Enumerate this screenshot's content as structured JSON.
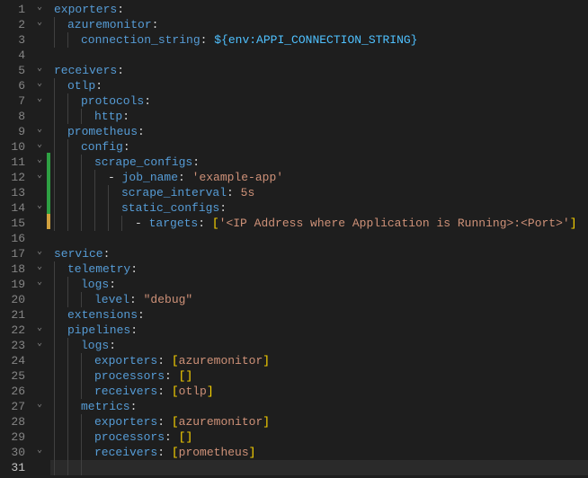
{
  "line_numbers": [
    "1",
    "2",
    "3",
    "4",
    "5",
    "6",
    "7",
    "8",
    "9",
    "10",
    "11",
    "12",
    "13",
    "14",
    "15",
    "16",
    "17",
    "18",
    "19",
    "20",
    "21",
    "22",
    "23",
    "24",
    "25",
    "26",
    "27",
    "28",
    "29",
    "30",
    "31"
  ],
  "fold_markers": {
    "1": "v",
    "2": "v",
    "3": "",
    "4": "",
    "5": "v",
    "6": "v",
    "7": "v",
    "8": "",
    "9": "v",
    "10": "v",
    "11": "v",
    "12": "v",
    "13": "",
    "14": "v",
    "15": "",
    "16": "",
    "17": "v",
    "18": "v",
    "19": "v",
    "20": "",
    "21": "",
    "22": "v",
    "23": "v",
    "24": "",
    "25": "",
    "26": "",
    "27": "v",
    "28": "",
    "29": "",
    "30": "v",
    "31": ""
  },
  "mod_markers": {
    "11": "green",
    "12": "green",
    "13": "green",
    "14": "green",
    "15": "yellow"
  },
  "yaml": {
    "l1": {
      "k": "exporters",
      "c": ":"
    },
    "l2": {
      "k": "azuremonitor",
      "c": ":"
    },
    "l3": {
      "k": "connection_string",
      "c": ": ",
      "v": "${env:APPI_CONNECTION_STRING}"
    },
    "l5": {
      "k": "receivers",
      "c": ":"
    },
    "l6": {
      "k": "otlp",
      "c": ":"
    },
    "l7": {
      "k": "protocols",
      "c": ":"
    },
    "l8": {
      "k": "http",
      "c": ":"
    },
    "l9": {
      "k": "prometheus",
      "c": ":"
    },
    "l10": {
      "k": "config",
      "c": ":"
    },
    "l11": {
      "k": "scrape_configs",
      "c": ":"
    },
    "l12": {
      "dash": "- ",
      "k": "job_name",
      "c": ": ",
      "v": "'example-app'"
    },
    "l13": {
      "k": "scrape_interval",
      "c": ": ",
      "v": "5s"
    },
    "l14": {
      "k": "static_configs",
      "c": ":"
    },
    "l15": {
      "dash": "- ",
      "k": "targets",
      "c": ": ",
      "lb": "[",
      "v": "'<IP Address where Application is Running>:<Port>'",
      "rb": "]"
    },
    "l17": {
      "k": "service",
      "c": ":"
    },
    "l18": {
      "k": "telemetry",
      "c": ":"
    },
    "l19": {
      "k": "logs",
      "c": ":"
    },
    "l20": {
      "k": "level",
      "c": ": ",
      "v": "\"debug\""
    },
    "l21": {
      "k": "extensions",
      "c": ":"
    },
    "l22": {
      "k": "pipelines",
      "c": ":"
    },
    "l23": {
      "k": "logs",
      "c": ":"
    },
    "l24": {
      "k": "exporters",
      "c": ": ",
      "lb": "[",
      "v": "azuremonitor",
      "rb": "]"
    },
    "l25": {
      "k": "processors",
      "c": ": ",
      "lb": "[",
      "rb": "]"
    },
    "l26": {
      "k": "receivers",
      "c": ": ",
      "lb": "[",
      "v": "otlp",
      "rb": "]"
    },
    "l27": {
      "k": "metrics",
      "c": ":"
    },
    "l28": {
      "k": "exporters",
      "c": ": ",
      "lb": "[",
      "v": "azuremonitor",
      "rb": "]"
    },
    "l29": {
      "k": "processors",
      "c": ": ",
      "lb": "[",
      "rb": "]"
    },
    "l30": {
      "k": "receivers",
      "c": ": ",
      "lb": "[",
      "v": "prometheus",
      "rb": "]"
    }
  },
  "active_line": "31"
}
